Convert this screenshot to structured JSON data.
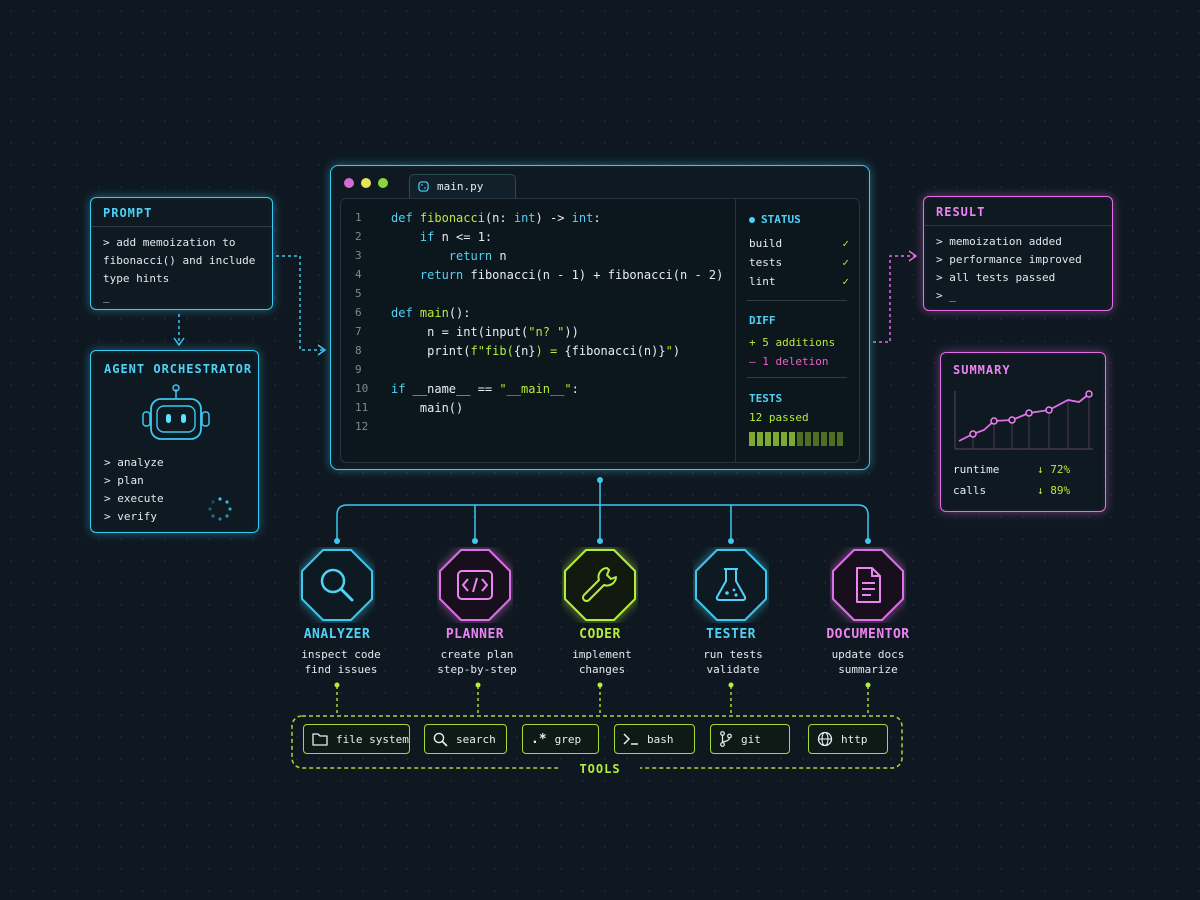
{
  "prompt": {
    "title": "PROMPT",
    "lines": [
      "> add memoization to",
      "fibonacci() and include",
      "type hints",
      "_"
    ]
  },
  "orchestrator": {
    "title": "AGENT ORCHESTRATOR",
    "steps": [
      "> analyze",
      "> plan",
      "> execute",
      "> verify"
    ]
  },
  "editor": {
    "tab": "main.py",
    "line_numbers": [
      "1",
      "2",
      "3",
      "4",
      "5",
      "6",
      "7",
      "8",
      "9",
      "10",
      "11",
      "12"
    ],
    "status": {
      "title": "STATUS",
      "checks": [
        {
          "label": "build",
          "mark": "✓"
        },
        {
          "label": "tests",
          "mark": "✓"
        },
        {
          "label": "lint",
          "mark": "✓"
        }
      ]
    },
    "diff": {
      "title": "DIFF",
      "additions": "+ 5  additions",
      "deletions": "– 1  deletion"
    },
    "tests": {
      "title": "TESTS",
      "passed": "12 passed"
    }
  },
  "result": {
    "title": "RESULT",
    "lines": [
      "> memoization added",
      "> performance improved",
      "> all tests passed",
      "> _"
    ]
  },
  "summary": {
    "title": "SUMMARY",
    "metrics": [
      {
        "label": "runtime",
        "value": "↓ 72%"
      },
      {
        "label": "calls",
        "value": "↓ 89%"
      }
    ]
  },
  "agents": [
    {
      "name": "ANALYZER",
      "desc1": "inspect code",
      "desc2": "find issues",
      "icon": "magnifier-icon",
      "color": "#3cc8f0"
    },
    {
      "name": "PLANNER",
      "desc1": "create plan",
      "desc2": "step-by-step",
      "icon": "code-brackets-icon",
      "color": "#e06ee8"
    },
    {
      "name": "CODER",
      "desc1": "implement",
      "desc2": "changes",
      "icon": "wrench-icon",
      "color": "#b5ee3a"
    },
    {
      "name": "TESTER",
      "desc1": "run tests",
      "desc2": "validate",
      "icon": "flask-icon",
      "color": "#3cc8f0"
    },
    {
      "name": "DOCUMENTOR",
      "desc1": "update docs",
      "desc2": "summarize",
      "icon": "document-icon",
      "color": "#e06ee8"
    }
  ],
  "tools": {
    "title": "TOOLS",
    "items": [
      {
        "label": "file system",
        "icon": "folder-icon"
      },
      {
        "label": "search",
        "icon": "search-icon"
      },
      {
        "label": "grep",
        "icon": "regex-icon",
        "glyph": ".*"
      },
      {
        "label": "bash",
        "icon": "terminal-icon"
      },
      {
        "label": "git",
        "icon": "git-branch-icon"
      },
      {
        "label": "http",
        "icon": "globe-icon"
      }
    ]
  },
  "colors": {
    "cyan": "#3cc8f0",
    "pink": "#e06ee8",
    "green": "#b5ee3a",
    "background": "#0f1820"
  }
}
